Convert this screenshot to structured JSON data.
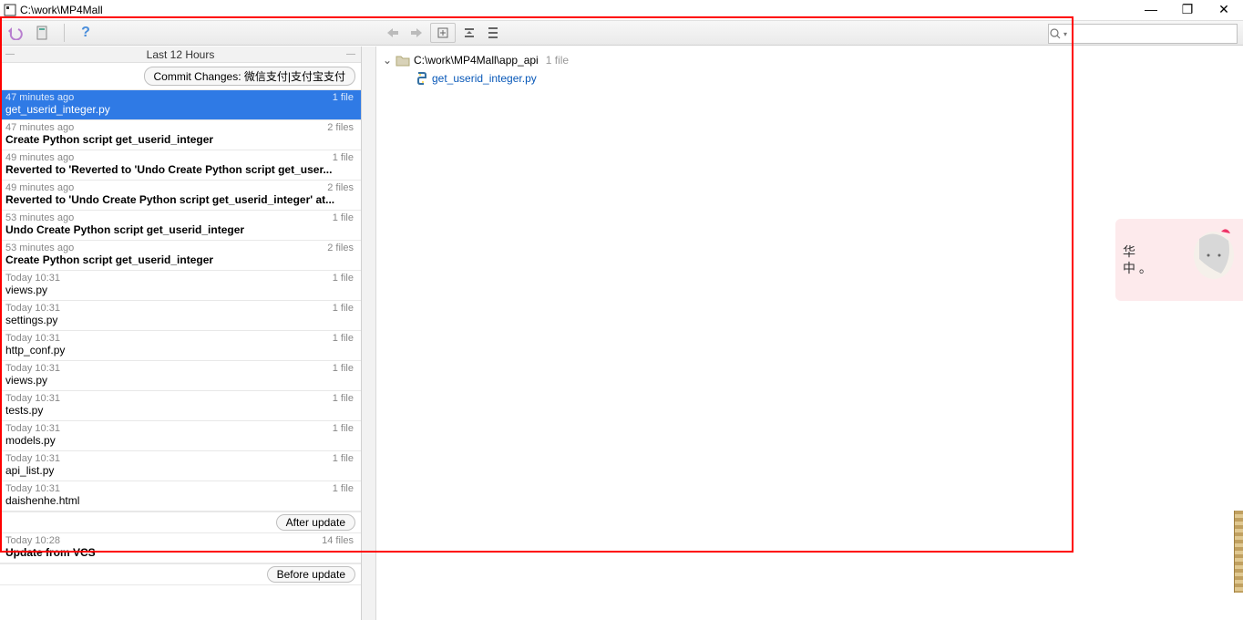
{
  "window": {
    "title": "C:\\work\\MP4Mall"
  },
  "toolbar": {
    "undo": "undo-icon",
    "config": "config-icon",
    "help": "?",
    "mid": [
      "nav-prev",
      "nav-next",
      "expand",
      "collapse-vert",
      "collapse-both"
    ]
  },
  "search": {
    "placeholder": ""
  },
  "left": {
    "section_title": "Last 12 Hours",
    "commit_pill": "Commit Changes: 微信支付|支付宝支付",
    "after_update_pill": "After update",
    "before_update_pill": "Before update",
    "items": [
      {
        "time": "47 minutes ago",
        "files": "1 file",
        "label": "get_userid_integer.py",
        "bold": false,
        "selected": true
      },
      {
        "time": "47 minutes ago",
        "files": "2 files",
        "label": "Create Python script get_userid_integer",
        "bold": true
      },
      {
        "time": "49 minutes ago",
        "files": "1 file",
        "label": "Reverted to 'Reverted to 'Undo Create Python script get_user...",
        "bold": true
      },
      {
        "time": "49 minutes ago",
        "files": "2 files",
        "label": "Reverted to 'Undo Create Python script get_userid_integer' at...",
        "bold": true
      },
      {
        "time": "53 minutes ago",
        "files": "1 file",
        "label": "Undo Create Python script get_userid_integer",
        "bold": true
      },
      {
        "time": "53 minutes ago",
        "files": "2 files",
        "label": "Create Python script get_userid_integer",
        "bold": true
      },
      {
        "time": "Today 10:31",
        "files": "1 file",
        "label": "views.py",
        "bold": false
      },
      {
        "time": "Today 10:31",
        "files": "1 file",
        "label": "settings.py",
        "bold": false
      },
      {
        "time": "Today 10:31",
        "files": "1 file",
        "label": "http_conf.py",
        "bold": false
      },
      {
        "time": "Today 10:31",
        "files": "1 file",
        "label": "views.py",
        "bold": false
      },
      {
        "time": "Today 10:31",
        "files": "1 file",
        "label": "tests.py",
        "bold": false
      },
      {
        "time": "Today 10:31",
        "files": "1 file",
        "label": "models.py",
        "bold": false
      },
      {
        "time": "Today 10:31",
        "files": "1 file",
        "label": "api_list.py",
        "bold": false
      },
      {
        "time": "Today 10:31",
        "files": "1 file",
        "label": "daishenhe.html",
        "bold": false
      }
    ],
    "post_items": [
      {
        "time": "Today 10:28",
        "files": "14 files",
        "label": "Update from VCS",
        "bold": true
      }
    ]
  },
  "right": {
    "path": "C:\\work\\MP4Mall\\app_api",
    "count": "1 file",
    "file": "get_userid_integer.py"
  },
  "widget": {
    "chars": "华\n中 。"
  }
}
